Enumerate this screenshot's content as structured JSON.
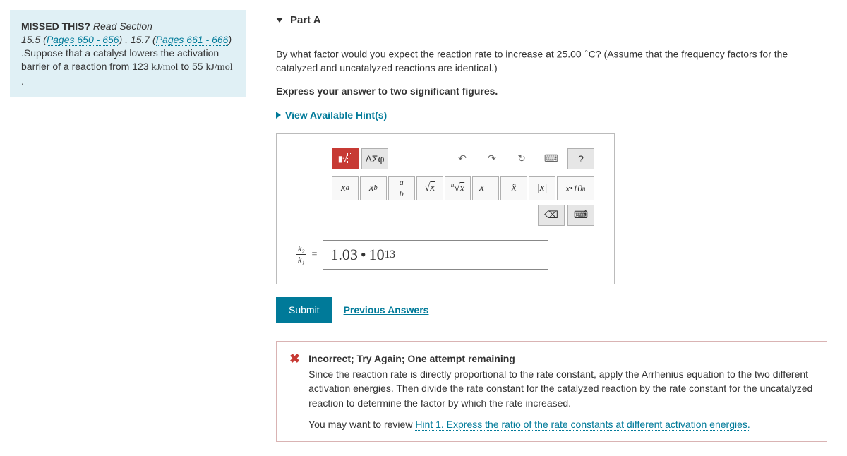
{
  "info": {
    "prefix": "MISSED THIS?",
    "read": " Read Section",
    "sec1_num": "15.5 (",
    "sec1_link": "Pages 650 - 656",
    "sec1_close": ") , ",
    "sec2_num": "15.7 (",
    "sec2_link": "Pages 661 - 666",
    "sec2_close": ")",
    "body_pre": ".Suppose that a catalyst lowers the activation barrier of a reaction from 123 ",
    "unit1": "kJ/mol",
    "body_mid": "  to 55 ",
    "unit2": "kJ/mol",
    "body_end": " ."
  },
  "part": {
    "label": "Part A",
    "q_pre": "By what factor would you expect the reaction rate to increase at 25.00 ",
    "q_deg": "∘",
    "q_c": "C",
    "q_post": "? (Assume that the frequency factors for the catalyzed and uncatalyzed reactions are identical.)",
    "instr": "Express your answer to two significant figures.",
    "hints": "View Available Hint(s)"
  },
  "toolbar": {
    "templates": "▮√▯",
    "greek": "ΑΣφ",
    "help": "?",
    "xa": "x",
    "xa_sup": "a",
    "xb": "x",
    "xb_sub": "b",
    "frac_a": "a",
    "frac_b": "b",
    "sqrt": "√x",
    "nsqrt": "∿√x",
    "vec": "x⃗",
    "hat": "x̂",
    "abs": "|x|",
    "sci": "x•10",
    "sci_n": "n"
  },
  "answer": {
    "k2": "k₂",
    "k1": "k₁",
    "eq": "=",
    "val_m": "1.03",
    "val_dot": "•",
    "val_b": "10",
    "val_e": "13"
  },
  "buttons": {
    "submit": "Submit",
    "prev": "Previous Answers"
  },
  "feedback": {
    "title": "Incorrect; Try Again; One attempt remaining",
    "body": "Since the reaction rate is directly proportional to the rate constant, apply the Arrhenius equation to the two different activation energies. Then divide the rate constant for the catalyzed reaction by the rate constant for the uncatalyzed reaction to determine the factor by which the rate increased.",
    "review_pre": "You may want to review ",
    "review_link": "Hint 1. Express the ratio of the rate constants at different activation energies."
  }
}
